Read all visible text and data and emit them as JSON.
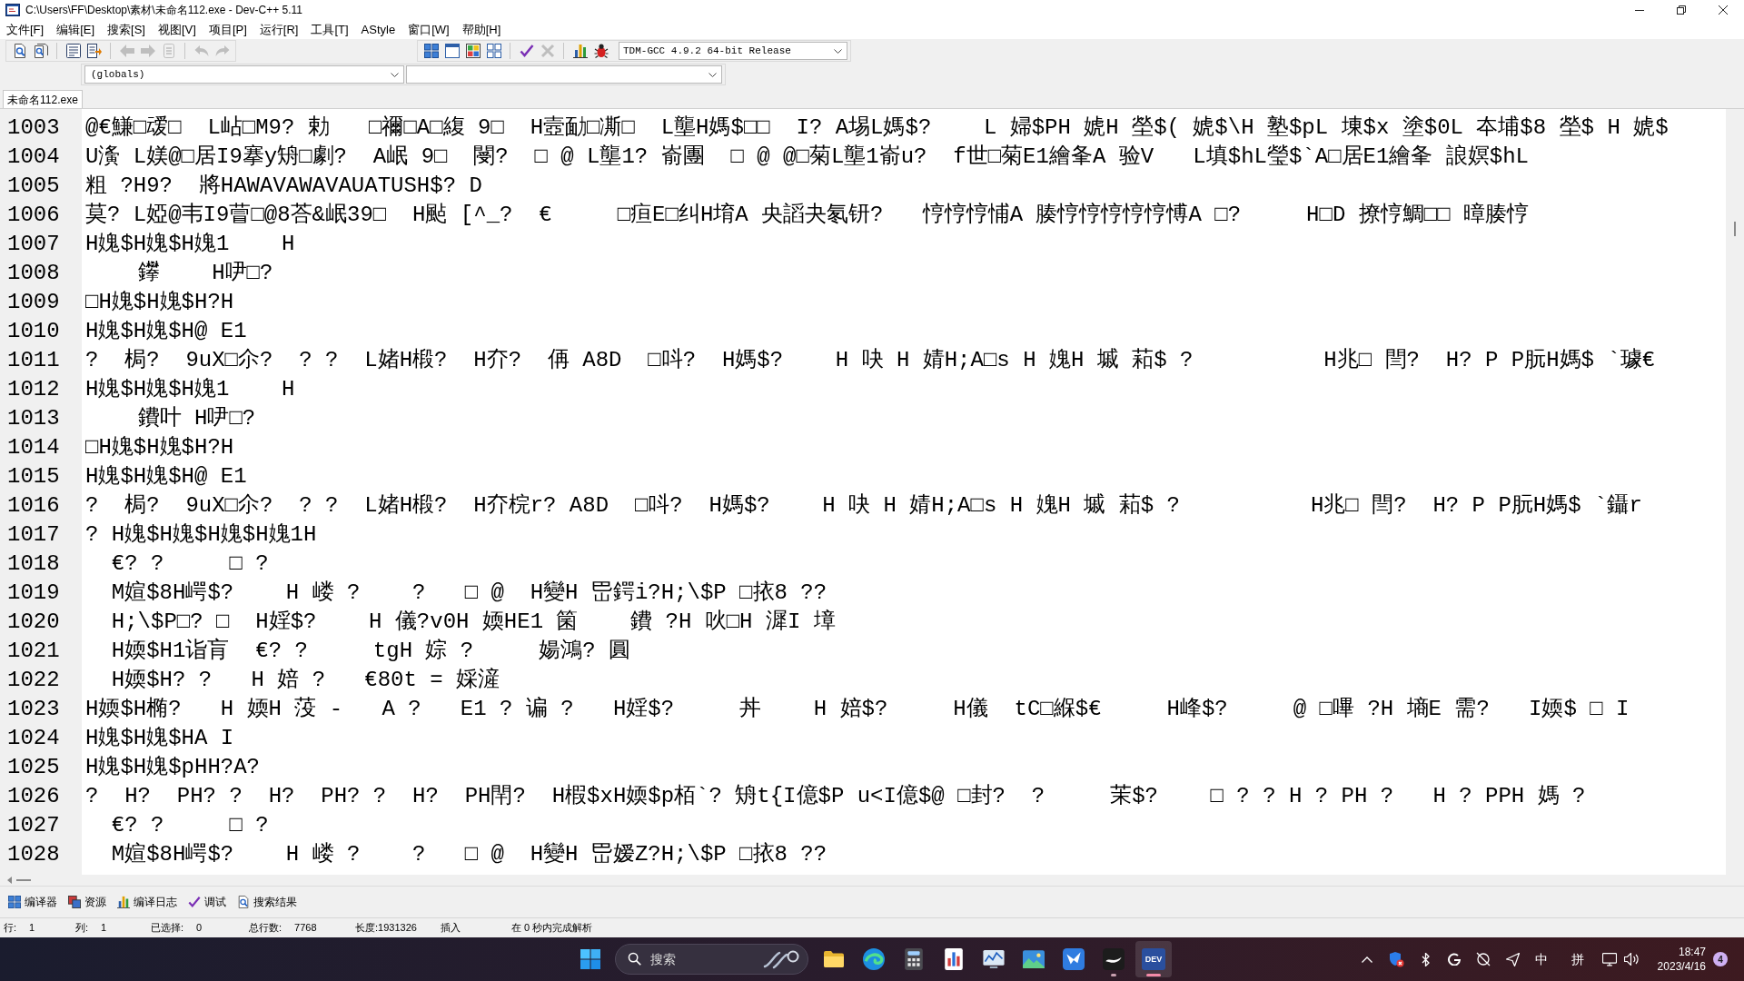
{
  "window": {
    "title": "C:\\Users\\FF\\Desktop\\素材\\未命名112.exe - Dev-C++ 5.11"
  },
  "menu_bar": [
    "文件[F]",
    "编辑[E]",
    "搜索[S]",
    "视图[V]",
    "项目[P]",
    "运行[R]",
    "工具[T]",
    "AStyle",
    "窗口[W]",
    "帮助[H]"
  ],
  "toolbar_main": {
    "groups": [
      {
        "buttons": [
          {
            "kind": "new",
            "disabled": false
          },
          {
            "kind": "open",
            "disabled": false
          }
        ]
      },
      {
        "buttons": [
          {
            "kind": "save",
            "disabled": false
          },
          {
            "kind": "save_all",
            "disabled": false
          }
        ]
      },
      {
        "buttons": [
          {
            "kind": "back",
            "disabled": true
          },
          {
            "kind": "forward",
            "disabled": true
          },
          {
            "kind": "close",
            "disabled": true
          }
        ]
      },
      {
        "buttons": [
          {
            "kind": "undo",
            "disabled": true
          },
          {
            "kind": "redo",
            "disabled": true
          }
        ]
      }
    ]
  },
  "toolbar_compile": {
    "groups": [
      {
        "buttons": [
          {
            "kind": "grid",
            "disabled": false
          },
          {
            "kind": "window",
            "disabled": false
          },
          {
            "kind": "color_grid",
            "disabled": false
          },
          {
            "kind": "tile",
            "disabled": false
          }
        ]
      },
      {
        "buttons": [
          {
            "kind": "check",
            "disabled": false
          },
          {
            "kind": "delete",
            "disabled": true
          }
        ]
      },
      {
        "buttons": [
          {
            "kind": "chart",
            "disabled": false
          },
          {
            "kind": "bug",
            "disabled": false
          }
        ]
      }
    ],
    "compiler": "TDM-GCC 4.9.2 64-bit Release"
  },
  "class_browser": {
    "scope": "(globals)"
  },
  "file_tabs": [
    {
      "label": "未命名112.exe",
      "selected": true
    }
  ],
  "editor": {
    "lines": [
      {
        "number": "1003",
        "text": "@€鰜□叆□  L岾□M9? 勅   □禰□A□緮 9□  H壼勔□凘□  L壟H媽$□□  I? A埸L媽$?    L 婦$PH 婋H 塋$( 婋$\\H 塾$pL 埬$x 塗$0L 夲埔$8 塋$ H 婋$"
      },
      {
        "number": "1004",
        "text": "U濥 L媄@□居I9搴y矪□劇?  A岷 9□  閿?  □ @ L壟1? 嵛團  □ @ @□菊L壟1嵛u?  f世□菊E1繪夆A 验V   L填$hL瑩$`A□居E1繪夆 誏嫇$hL"
      },
      {
        "number": "1005",
        "text": "粗 ?H9?  將HAWAVAWAVAUATUSH$? D"
      },
      {
        "number": "1006",
        "text": "莫? L婭@韦I9萺□@8荅&岷39□  H颭 [^_?  €     □疸E□纠H堉A 央謟夬氡钘?   悙悙悙悑A 腠悙悙悙悙悙愽A □?     H□D 撩悙鯛□□ 暲腠悙"
      },
      {
        "number": "1007",
        "text": "H媿$H媿$H媿1    H"
      },
      {
        "number": "1008",
        "text": "    鑻    H吚□?"
      },
      {
        "number": "1009",
        "text": "□H媿$H媿$H?H"
      },
      {
        "number": "1010",
        "text": "H媿$H媿$H@ E1"
      },
      {
        "number": "1011",
        "text": "?  梮?  9uX□尒?  ? ?  L媎H椴?  H夰?  侢 A8D  □呌?  H媽$?    H 吷 H 婧H;A□s H 媿H 墄 萂$ ?          H兆□ 閆?  H? P P朊H媽$ `璩€"
      },
      {
        "number": "1012",
        "text": "H媿$H媿$H媿1    H"
      },
      {
        "number": "1013",
        "text": "    鐨叶 H吚□?"
      },
      {
        "number": "1014",
        "text": "□H媿$H媿$H?H"
      },
      {
        "number": "1015",
        "text": "H媿$H媿$H@ E1"
      },
      {
        "number": "1016",
        "text": "?  梮?  9uX□尒?  ? ?  L媎H椴?  H夰梡r? A8D  □呌?  H媽$?    H 吷 H 婧H;A□s H 媿H 墄 萂$ ?          H兆□ 閆?  H? P P朊H媽$ `鑷r"
      },
      {
        "number": "1017",
        "text": "? H媿$H媿$H媿$H媿1H"
      },
      {
        "number": "1018",
        "text": "  €? ?     □ ?"
      },
      {
        "number": "1019",
        "text": "  M媗$8H崿$?    H 嵝 ?    ?   □ @  H變H 岊鍔i?H;\\$P □挔8 ??"
      },
      {
        "number": "1020",
        "text": "  H;\\$P□? □  H婬$?    H 儀?v0H 媆HE1 箘    鐨 ?H 吙□H 漽I 墇"
      },
      {
        "number": "1021",
        "text": "  H媆$H1诣肓  €? ?     tgH 婃 ?     婸鴻? 圓"
      },
      {
        "number": "1022",
        "text": "  H媆$H? ?   H 婄 ?   €80t = 婇滻"
      },
      {
        "number": "1023",
        "text": "H媆$H椭?   H 媆H 莈 -   A ?   E1 ? 谝 ?   H婬$?     丼    H 婄$?     H儀  tC□緥$€     H峰$?     @ □嗶 ?H 墒E 需?   I媆$ □ I"
      },
      {
        "number": "1024",
        "text": "H媿$H媿$HA I"
      },
      {
        "number": "1025",
        "text": "H媿$H媿$pHH?A?"
      },
      {
        "number": "1026",
        "text": "?  H?  PH? ?  H?  PH? ?  H?  PH閈?  H椵$xH媆$p栢`? 矪t{I億$P u<I億$@ □封?  ?     茉$?    □ ? ? H ? PH ?   H ? PPH 媽 ?"
      },
      {
        "number": "1027",
        "text": "  €? ?     □ ?"
      },
      {
        "number": "1028",
        "text": "  M媗$8H崿$?    H 嵝 ?    ?   □ @  H變H 岊嫒Z?H;\\$P □挔8 ??"
      }
    ]
  },
  "bottom_tabs": [
    {
      "kind": "grid",
      "label": "编译器",
      "selected": false
    },
    {
      "kind": "layers",
      "label": "资源",
      "selected": false
    },
    {
      "kind": "chart",
      "label": "编译日志",
      "selected": false
    },
    {
      "kind": "check",
      "label": "调试",
      "selected": false
    },
    {
      "kind": "find",
      "label": "搜索结果",
      "selected": false
    }
  ],
  "status_bar": [
    {
      "label": "行:",
      "value": "1"
    },
    {
      "label": "列:",
      "value": "1"
    },
    {
      "label": "已选择:",
      "value": "0"
    },
    {
      "label": "总行数:",
      "value": "7768"
    },
    {
      "label": "长度:1931326"
    },
    {
      "label": "插入"
    },
    {
      "label": "在 0 秒内完成解析"
    }
  ],
  "taskbar": {
    "search": {
      "placeholder": "搜索"
    },
    "apps": [
      {
        "kind": "folder",
        "running": false,
        "active": false
      },
      {
        "kind": "wave",
        "running": false,
        "active": false
      },
      {
        "kind": "calculator",
        "running": false,
        "active": false
      },
      {
        "kind": "doc_chart",
        "running": false,
        "active": false
      },
      {
        "kind": "line_chart",
        "running": false,
        "active": false
      },
      {
        "kind": "picture",
        "running": false,
        "active": false
      },
      {
        "kind": "bird",
        "running": false,
        "active": false
      },
      {
        "kind": "swoosh",
        "running": true,
        "active": false
      },
      {
        "kind": "dev",
        "label": "DEV",
        "running": true,
        "active": true
      }
    ],
    "tray": {
      "ime_language": "中",
      "ime_mode": "拼",
      "time": "18:47",
      "date": "2023/4/16",
      "notification_count": "4"
    }
  }
}
